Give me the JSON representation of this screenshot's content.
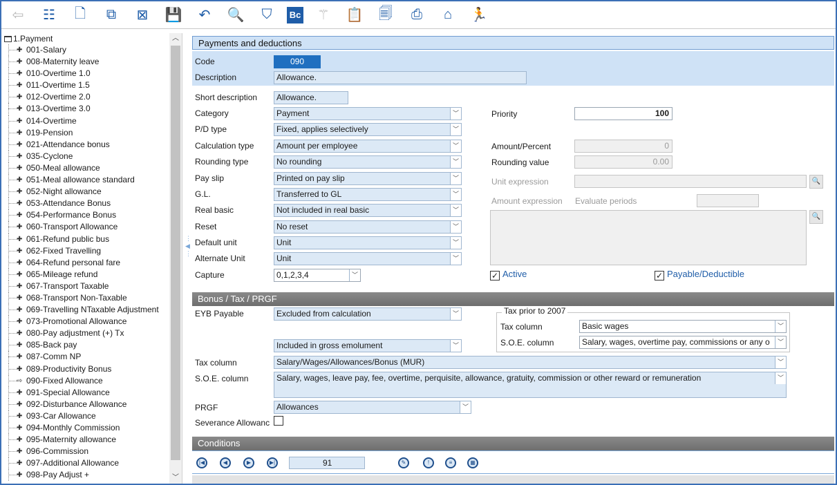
{
  "toolbar": {
    "buttons": [
      {
        "name": "back-arrow-icon",
        "glyph": "⇦",
        "enabled": false
      },
      {
        "name": "tree-view-icon",
        "glyph": "☷"
      },
      {
        "name": "new-document-icon",
        "glyph": "🗋"
      },
      {
        "name": "copy-document-icon",
        "glyph": "⧉"
      },
      {
        "name": "delete-document-icon",
        "glyph": "⊠"
      },
      {
        "name": "save-icon",
        "glyph": "💾"
      },
      {
        "name": "undo-icon",
        "glyph": "↶"
      },
      {
        "name": "search-icon",
        "glyph": "🔍"
      },
      {
        "name": "filter-icon",
        "glyph": "⛉"
      },
      {
        "name": "b-c-icon",
        "glyph": "Bc"
      },
      {
        "name": "magic-wand-icon",
        "glyph": "⚚",
        "enabled": false
      },
      {
        "name": "clipboard-icon",
        "glyph": "📋"
      },
      {
        "name": "preview-icon",
        "glyph": "🗐"
      },
      {
        "name": "print-icon",
        "glyph": "⎙"
      },
      {
        "name": "home-icon",
        "glyph": "⌂"
      },
      {
        "name": "exit-runner-icon",
        "glyph": "🏃"
      }
    ]
  },
  "tree": {
    "root": "1.Payment",
    "items": [
      "001-Salary",
      "008-Maternity leave",
      "010-Overtime 1.0",
      "011-Overtime 1.5",
      "012-Overtime 2.0",
      "013-Overtime 3.0",
      "014-Overtime",
      "019-Pension",
      "021-Attendance bonus",
      "035-Cyclone",
      "050-Meal allowance",
      "051-Meal allowance standard",
      "052-Night allowance",
      "053-Attendance Bonus",
      "054-Performance Bonus",
      "060-Transport  Allowance",
      "061-Refund public bus",
      "062-Fixed Travelling",
      "064-Refund personal fare",
      "065-Mileage refund",
      "067-Transport Taxable",
      "068-Transport Non-Taxable",
      "069-Travelling NTaxable Adjustment",
      "073-Promotional Allowance",
      "080-Pay adjustment (+) Tx",
      "085-Back pay",
      "087-Comm NP",
      "089-Productivity Bonus",
      "090-Fixed Allowance",
      "091-Special Allowance",
      "092-Disturbance Allowance",
      "093-Car Allowance",
      "094-Monthly Commission",
      "095-Maternity allowance",
      "096-Commission",
      "097-Additional Allowance",
      "098-Pay Adjust +"
    ],
    "selected_index": 28
  },
  "form": {
    "section_title": "Payments and deductions",
    "code_label": "Code",
    "code_value": "090",
    "description_label": "Description",
    "description_value": "Allowance.",
    "short_description_label": "Short description",
    "short_description_value": "Allowance.",
    "category_label": "Category",
    "category_value": "Payment",
    "pd_type_label": "P/D type",
    "pd_type_value": "Fixed, applies selectively",
    "calc_type_label": "Calculation type",
    "calc_type_value": "Amount per employee",
    "rounding_type_label": "Rounding type",
    "rounding_type_value": "No rounding",
    "pay_slip_label": "Pay slip",
    "pay_slip_value": "Printed on pay slip",
    "gl_label": "G.L.",
    "gl_value": "Transferred to GL",
    "real_basic_label": "Real basic",
    "real_basic_value": "Not included in real basic",
    "reset_label": "Reset",
    "reset_value": "No reset",
    "default_unit_label": "Default unit",
    "default_unit_value": "Unit",
    "alternate_unit_label": "Alternate Unit",
    "alternate_unit_value": "Unit",
    "capture_label": "Capture",
    "capture_value": "0,1,2,3,4",
    "priority_label": "Priority",
    "priority_value": "100",
    "amount_percent_label": "Amount/Percent",
    "amount_percent_value": "0",
    "rounding_value_label": "Rounding value",
    "rounding_value_value": "0.00",
    "unit_expression_label": "Unit expression",
    "amount_expression_label": "Amount expression",
    "evaluate_periods_label": "Evaluate periods",
    "active_label": "Active",
    "active_checked": true,
    "payable_label": "Payable/Deductible",
    "payable_checked": true
  },
  "bonus": {
    "section_title": "Bonus / Tax / PRGF",
    "eyb_label": "EYB Payable",
    "eyb_value": "Excluded from calculation",
    "gross_value": "Included in gross emolument",
    "tax_prior_title": "Tax prior to 2007",
    "tax_prior_tax_label": "Tax column",
    "tax_prior_tax_value": "Basic wages",
    "tax_prior_soe_label": "S.O.E. column",
    "tax_prior_soe_value": "Salary, wages, overtime pay, commissions or any o",
    "tax_column_label": "Tax column",
    "tax_column_value": "Salary/Wages/Allowances/Bonus (MUR)",
    "soe_label": "S.O.E. column",
    "soe_value": "Salary, wages, leave pay, fee, overtime, perquisite, allowance, gratuity, commission or other reward or remuneration",
    "prgf_label": "PRGF",
    "prgf_value": "Allowances",
    "severance_label": "Severance Allowanc",
    "severance_checked": false
  },
  "conditions": {
    "section_title": "Conditions"
  },
  "navigation": {
    "record_number": "91"
  }
}
